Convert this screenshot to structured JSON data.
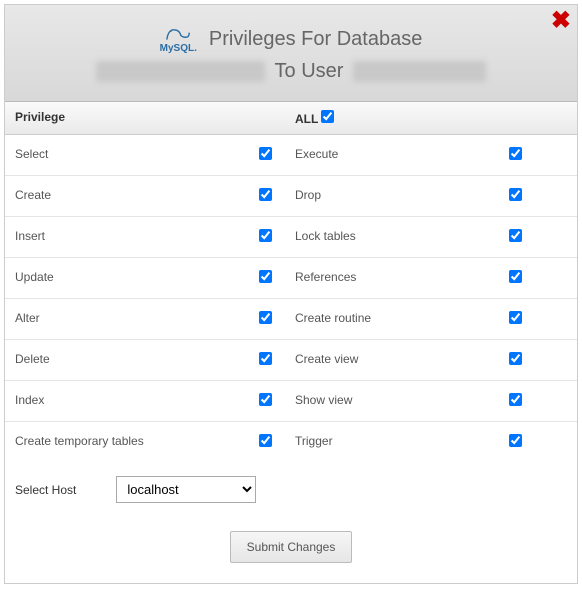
{
  "header": {
    "logo_text": "MySQL.",
    "title_line1": "Privileges For Database",
    "to_user_label": "To User"
  },
  "table": {
    "privilege_header": "Privilege",
    "all_header": "ALL",
    "all_checked": true,
    "rows": [
      {
        "left": "Select",
        "left_checked": true,
        "right": "Execute",
        "right_checked": true
      },
      {
        "left": "Create",
        "left_checked": true,
        "right": "Drop",
        "right_checked": true
      },
      {
        "left": "Insert",
        "left_checked": true,
        "right": "Lock tables",
        "right_checked": true
      },
      {
        "left": "Update",
        "left_checked": true,
        "right": "References",
        "right_checked": true
      },
      {
        "left": "Alter",
        "left_checked": true,
        "right": "Create routine",
        "right_checked": true
      },
      {
        "left": "Delete",
        "left_checked": true,
        "right": "Create view",
        "right_checked": true
      },
      {
        "left": "Index",
        "left_checked": true,
        "right": "Show view",
        "right_checked": true
      },
      {
        "left": "Create temporary tables",
        "left_checked": true,
        "right": "Trigger",
        "right_checked": true
      }
    ]
  },
  "host": {
    "label": "Select Host",
    "selected": "localhost",
    "options": [
      "localhost"
    ]
  },
  "submit": {
    "label": "Submit Changes"
  }
}
